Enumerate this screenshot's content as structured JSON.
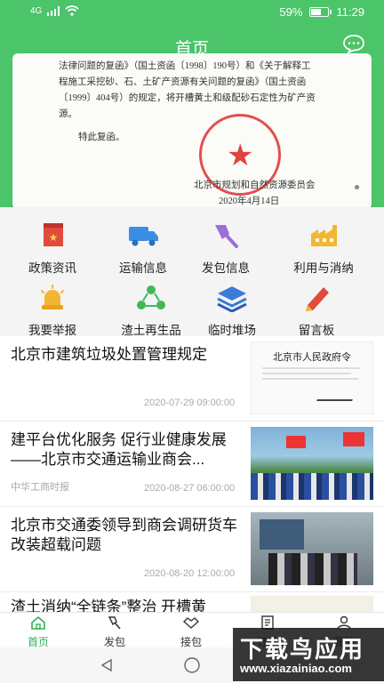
{
  "status": {
    "signal": "4G",
    "battery_text": "59%",
    "battery_level": 0.59,
    "time": "11:29"
  },
  "header": {
    "title": "首页"
  },
  "banner": {
    "lines": [
      "法律问题的复函》（国土资函〔1998〕190号）和《关于解释工",
      "程施工采挖砂、石、土矿产资源有关问题的复函》（国土资函",
      "〔1999〕404号）的规定，将开槽黄土和级配砂石定性为矿产资",
      "源。"
    ],
    "closing": "特此复函。",
    "signature": "北京市规划和自然资源委员会",
    "date": "2020年4月14日"
  },
  "menu": [
    {
      "label": "政策资讯",
      "icon": "policy-icon"
    },
    {
      "label": "运输信息",
      "icon": "truck-icon"
    },
    {
      "label": "发包信息",
      "icon": "shovel-icon"
    },
    {
      "label": "利用与消纳",
      "icon": "factory-icon"
    },
    {
      "label": "我要举报",
      "icon": "alarm-icon"
    },
    {
      "label": "渣土再生品",
      "icon": "recycle-icon"
    },
    {
      "label": "临时堆场",
      "icon": "stack-icon"
    },
    {
      "label": "留言板",
      "icon": "pen-icon"
    }
  ],
  "news": [
    {
      "title": "北京市建筑垃圾处置管理规定",
      "source": "",
      "date": "2020-07-29 09:00:00",
      "thumb_caption": "北京市人民政府令"
    },
    {
      "title": "建平台优化服务 促行业健康发展——北京市交通运输业商会...",
      "source": "中华工商时报",
      "date": "2020-08-27 06:00:00"
    },
    {
      "title": "北京市交通委领导到商会调研货车改装超载问题",
      "source": "",
      "date": "2020-08-20 12:00:00"
    },
    {
      "title": "渣土消纳“全链条”整治 开槽黄",
      "source": "",
      "date": ""
    }
  ],
  "tabs": [
    {
      "label": "首页",
      "icon": "home-icon"
    },
    {
      "label": "发包",
      "icon": "shovel-outline-icon"
    },
    {
      "label": "接包",
      "icon": "handshake-icon"
    },
    {
      "label": "订单",
      "icon": "order-icon"
    },
    {
      "label": "我的",
      "icon": "person-icon"
    }
  ],
  "watermark": {
    "big": "下载鸟应用",
    "small": "www.xiazainiao.com"
  },
  "colors": {
    "brand": "#4cc46a",
    "active_tab": "#2eb155"
  }
}
